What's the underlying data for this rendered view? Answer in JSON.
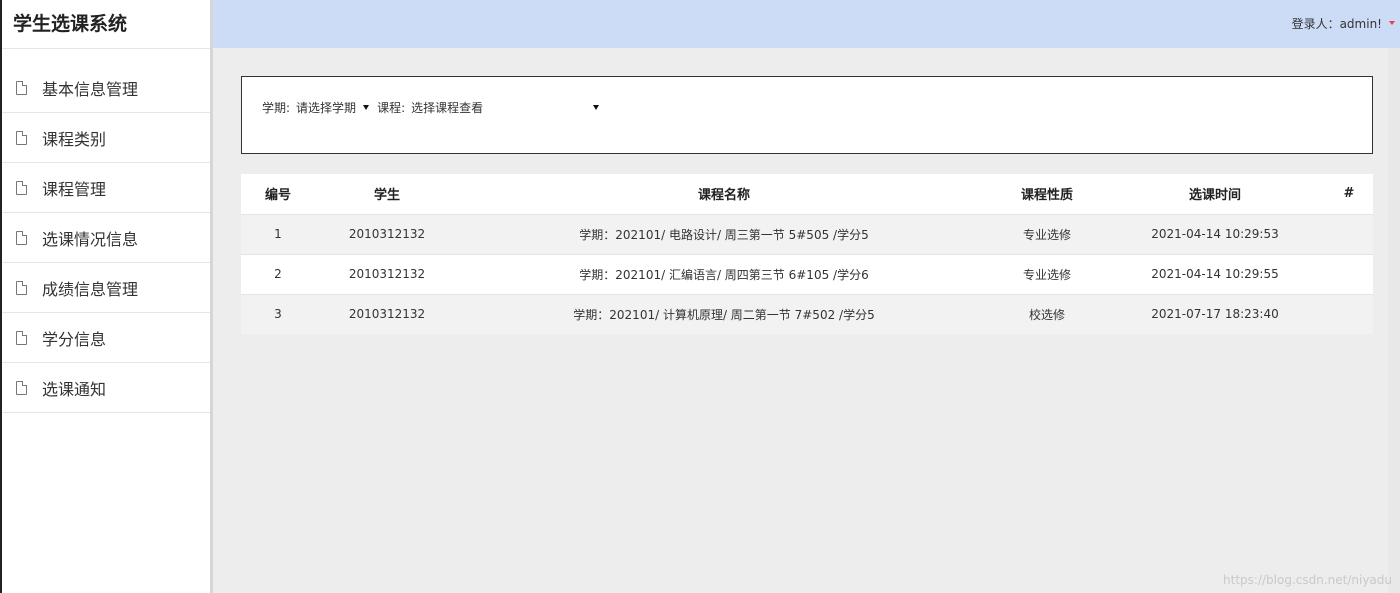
{
  "app": {
    "title": "学生选课系统"
  },
  "sidebar": {
    "items": [
      {
        "label": "基本信息管理",
        "icon": "document-icon"
      },
      {
        "label": "课程类别",
        "icon": "document-icon"
      },
      {
        "label": "课程管理",
        "icon": "document-icon"
      },
      {
        "label": "选课情况信息",
        "icon": "document-icon"
      },
      {
        "label": "成绩信息管理",
        "icon": "document-icon"
      },
      {
        "label": "学分信息",
        "icon": "document-icon"
      },
      {
        "label": "选课通知",
        "icon": "document-icon"
      }
    ]
  },
  "header": {
    "login_text": "登录人：admin!",
    "accent_color": "#e0453a"
  },
  "filters": {
    "semester_label": "学期:",
    "semester_value": "请选择学期",
    "course_label": "课程:",
    "course_value": "选择课程查看"
  },
  "table": {
    "columns": [
      "编号",
      "学生",
      "课程名称",
      "课程性质",
      "选课时间",
      "#"
    ],
    "rows": [
      [
        "1",
        "2010312132",
        "学期：202101/ 电路设计/ 周三第一节 5#505 /学分5",
        "专业选修",
        "2021-04-14 10:29:53",
        ""
      ],
      [
        "2",
        "2010312132",
        "学期：202101/ 汇编语言/ 周四第三节 6#105 /学分6",
        "专业选修",
        "2021-04-14 10:29:55",
        ""
      ],
      [
        "3",
        "2010312132",
        "学期：202101/ 计算机原理/ 周二第一节 7#502 /学分5",
        "校选修",
        "2021-07-17 18:23:40",
        ""
      ]
    ]
  },
  "watermark": "https://blog.csdn.net/niyadu"
}
